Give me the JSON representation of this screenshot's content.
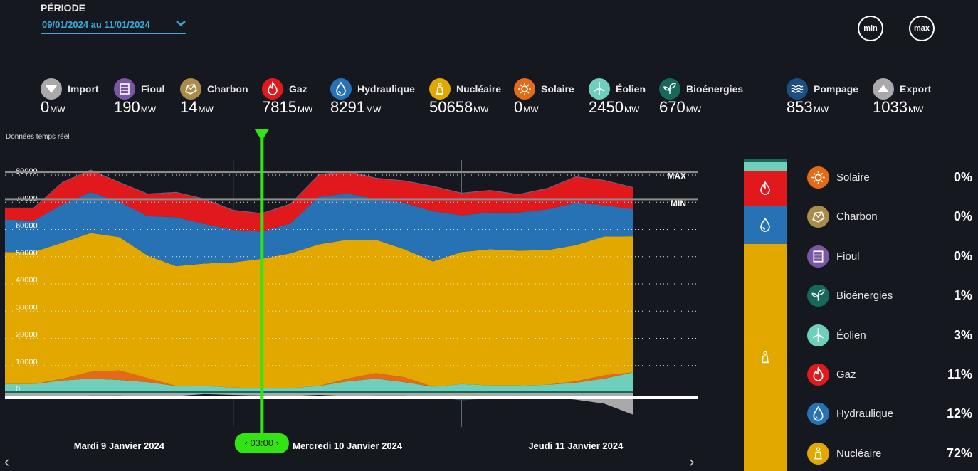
{
  "periode": {
    "label": "PÉRIODE",
    "value": "09/01/2024 au 11/01/2024"
  },
  "buttons": {
    "min": "min",
    "max": "max"
  },
  "unit": "MW",
  "sources": [
    {
      "key": "import",
      "name": "Import",
      "value": "0",
      "color": "#a9a9a9",
      "icon": "arrow-down-icon"
    },
    {
      "key": "fioul",
      "name": "Fioul",
      "value": "190",
      "color": "#7a57a3",
      "icon": "fuel-oil-icon"
    },
    {
      "key": "charbon",
      "name": "Charbon",
      "value": "14",
      "color": "#a98c4c",
      "icon": "coal-icon"
    },
    {
      "key": "gaz",
      "name": "Gaz",
      "value": "7815",
      "color": "#e2191c",
      "icon": "flame-icon"
    },
    {
      "key": "hydraulique",
      "name": "Hydraulique",
      "value": "8291",
      "color": "#2672b5",
      "icon": "water-drop-icon"
    },
    {
      "key": "nucleaire",
      "name": "Nucléaire",
      "value": "50658",
      "color": "#e3a800",
      "icon": "nuclear-plant-icon"
    },
    {
      "key": "solaire",
      "name": "Solaire",
      "value": "0",
      "color": "#e46a16",
      "icon": "sun-icon"
    },
    {
      "key": "eolien",
      "name": "Éolien",
      "value": "2450",
      "color": "#6fcfbd",
      "icon": "wind-turbine-icon"
    },
    {
      "key": "bioenergies",
      "name": "Bioénergies",
      "value": "670",
      "color": "#16685a",
      "icon": "leaf-icon"
    },
    {
      "key": "pompage",
      "name": "Pompage",
      "value": "853",
      "color": "#1d4e80",
      "icon": "waves-icon"
    },
    {
      "key": "export",
      "name": "Export",
      "value": "1033",
      "color": "#a9a9a9",
      "icon": "arrow-up-icon"
    }
  ],
  "chart_data": {
    "type": "area",
    "label": "Données temps réel",
    "ylim": [
      -10000,
      85000
    ],
    "yticks": [
      0,
      10000,
      20000,
      30000,
      40000,
      50000,
      60000,
      70000,
      80000
    ],
    "grid": true,
    "reference_lines": [
      {
        "label": "MAX",
        "value": 78000
      },
      {
        "label": "MIN",
        "value": 68000
      }
    ],
    "xlim": [
      0,
      72
    ],
    "x_unit": "hours since 09/01/2024 00:00",
    "day_labels": [
      {
        "label": "Mardi 9 Janvier 2024",
        "at": 12
      },
      {
        "label": "Mercredi 10 Janvier 2024",
        "at": 36
      },
      {
        "label": "Jeudi 11 Janvier 2024",
        "at": 60
      }
    ],
    "cursor": {
      "at": 27,
      "label": "03:00"
    },
    "x": [
      0,
      3,
      6,
      9,
      12,
      15,
      18,
      21,
      24,
      27,
      30,
      33,
      36,
      39,
      42,
      45,
      48,
      51,
      54,
      57,
      60,
      63,
      66
    ],
    "series": [
      {
        "name": "Bioénergies",
        "color": "#16685a",
        "values": [
          700,
          700,
          700,
          700,
          700,
          700,
          700,
          700,
          700,
          700,
          700,
          700,
          700,
          700,
          700,
          700,
          700,
          700,
          700,
          700,
          700,
          700,
          700
        ]
      },
      {
        "name": "Éolien",
        "color": "#6fcfbd",
        "values": [
          2500,
          2500,
          3800,
          4500,
          4000,
          3200,
          1800,
          1800,
          1200,
          1000,
          1000,
          1800,
          3500,
          4500,
          3200,
          1500,
          2500,
          2000,
          2000,
          2200,
          3000,
          4500,
          6800
        ]
      },
      {
        "name": "Solaire",
        "color": "#e46a16",
        "values": [
          0,
          0,
          600,
          2500,
          3500,
          1500,
          0,
          0,
          0,
          0,
          0,
          0,
          1000,
          2000,
          1800,
          0,
          0,
          0,
          0,
          0,
          500,
          1200,
          0
        ]
      },
      {
        "name": "Nucléaire",
        "color": "#e3a800",
        "values": [
          48500,
          48500,
          50000,
          51000,
          49000,
          45000,
          44000,
          45000,
          46000,
          47500,
          49500,
          52000,
          51000,
          49000,
          47000,
          46000,
          48500,
          50000,
          49500,
          49500,
          50000,
          51000,
          50000
        ]
      },
      {
        "name": "Hydraulique",
        "color": "#2672b5",
        "values": [
          12000,
          11500,
          14000,
          15000,
          13000,
          14500,
          18000,
          14500,
          12000,
          10000,
          11000,
          17500,
          17000,
          15000,
          17000,
          18500,
          13500,
          13500,
          14000,
          15000,
          15500,
          11500,
          10000
        ]
      },
      {
        "name": "Gaz",
        "color": "#e2191c",
        "values": [
          4000,
          4500,
          8000,
          8000,
          7000,
          8000,
          9000,
          9000,
          7000,
          6500,
          7000,
          8000,
          8000,
          7500,
          8000,
          9000,
          8000,
          8000,
          6500,
          7500,
          9500,
          9000,
          7800
        ]
      },
      {
        "name": "Charbon",
        "color": "#a98c4c",
        "values": [
          100,
          100,
          100,
          100,
          100,
          100,
          100,
          100,
          100,
          100,
          100,
          100,
          100,
          100,
          100,
          100,
          100,
          100,
          100,
          100,
          100,
          100,
          100
        ]
      },
      {
        "name": "Fioul",
        "color": "#7a57a3",
        "values": [
          200,
          200,
          200,
          200,
          200,
          200,
          200,
          200,
          200,
          200,
          200,
          200,
          200,
          200,
          200,
          200,
          200,
          200,
          200,
          200,
          200,
          200,
          200
        ]
      }
    ],
    "negative_series": [
      {
        "name": "Export",
        "color": "#a9a9a9",
        "values": [
          -1000,
          -1500,
          -1500,
          -1000,
          -1000,
          -1200,
          -1200,
          -500,
          -800,
          -1000,
          -1200,
          -800,
          -1200,
          -1000,
          -1000,
          -1500,
          -2000,
          -2000,
          -1500,
          -1500,
          -2500,
          -4000,
          -8000
        ]
      },
      {
        "name": "Pompage",
        "color": "#1d4e80",
        "values": [
          0,
          -800,
          0,
          0,
          0,
          -800,
          0,
          0,
          0,
          -900,
          0,
          0,
          0,
          0,
          0,
          0,
          -800,
          0,
          -800,
          0,
          0,
          0,
          0
        ]
      }
    ],
    "mix": [
      {
        "name": "Solaire",
        "pct": "0%",
        "value": 0,
        "color": "#e46a16",
        "icon": "sun-icon"
      },
      {
        "name": "Charbon",
        "pct": "0%",
        "value": 0,
        "color": "#a98c4c",
        "icon": "coal-icon"
      },
      {
        "name": "Fioul",
        "pct": "0%",
        "value": 0,
        "color": "#7a57a3",
        "icon": "fuel-oil-icon"
      },
      {
        "name": "Bioénergies",
        "pct": "1%",
        "value": 1,
        "color": "#16685a",
        "icon": "leaf-icon"
      },
      {
        "name": "Éolien",
        "pct": "3%",
        "value": 3,
        "color": "#6fcfbd",
        "icon": "wind-turbine-icon"
      },
      {
        "name": "Gaz",
        "pct": "11%",
        "value": 11,
        "color": "#e2191c",
        "icon": "flame-icon"
      },
      {
        "name": "Hydraulique",
        "pct": "12%",
        "value": 12,
        "color": "#2672b5",
        "icon": "water-drop-icon"
      },
      {
        "name": "Nucléaire",
        "pct": "72%",
        "value": 72,
        "color": "#e3a800",
        "icon": "nuclear-plant-icon"
      }
    ]
  }
}
